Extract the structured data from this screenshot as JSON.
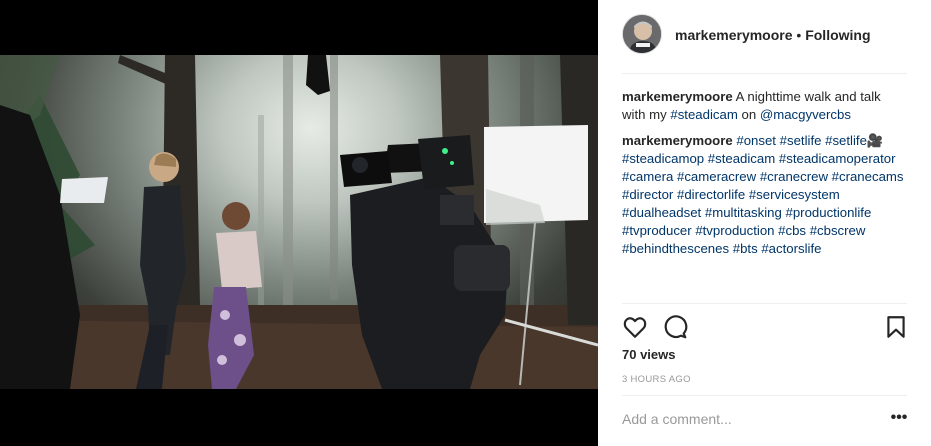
{
  "post": {
    "author": "markemerymoore",
    "follow_status": "Following",
    "separator": "•",
    "avatar_icon": "user-avatar-icon",
    "media_type": "video",
    "caption": {
      "user": "markemerymoore",
      "text_1": "A nighttime walk and talk with my",
      "tag_steadicam": "#steadicam",
      "text_2": "on",
      "mention": "@macgyvercbs"
    },
    "hashtags_comment": {
      "user": "markemerymoore",
      "tags": [
        "#onset",
        "#setlife",
        "#setlife",
        "#steadicamop",
        "#steadicam",
        "#steadicamoperator",
        "#camera",
        "#cameracrew",
        "#cranecrew",
        "#cranecams",
        "#director",
        "#directorlife",
        "#servicesystem",
        "#dualheadset",
        "#multitasking",
        "#productionlife",
        "#tvproducer",
        "#tvproduction",
        "#cbs",
        "#cbscrew",
        "#behindthescenes",
        "#bts",
        "#actorslife"
      ],
      "emoji": "🎥"
    },
    "views": "70 views",
    "timestamp": "3 HOURS AGO",
    "comment_placeholder": "Add a comment...",
    "more_label": "•••",
    "icons": {
      "like": "heart-icon",
      "comment": "comment-icon",
      "save": "bookmark-icon",
      "more": "more-options-icon"
    }
  }
}
